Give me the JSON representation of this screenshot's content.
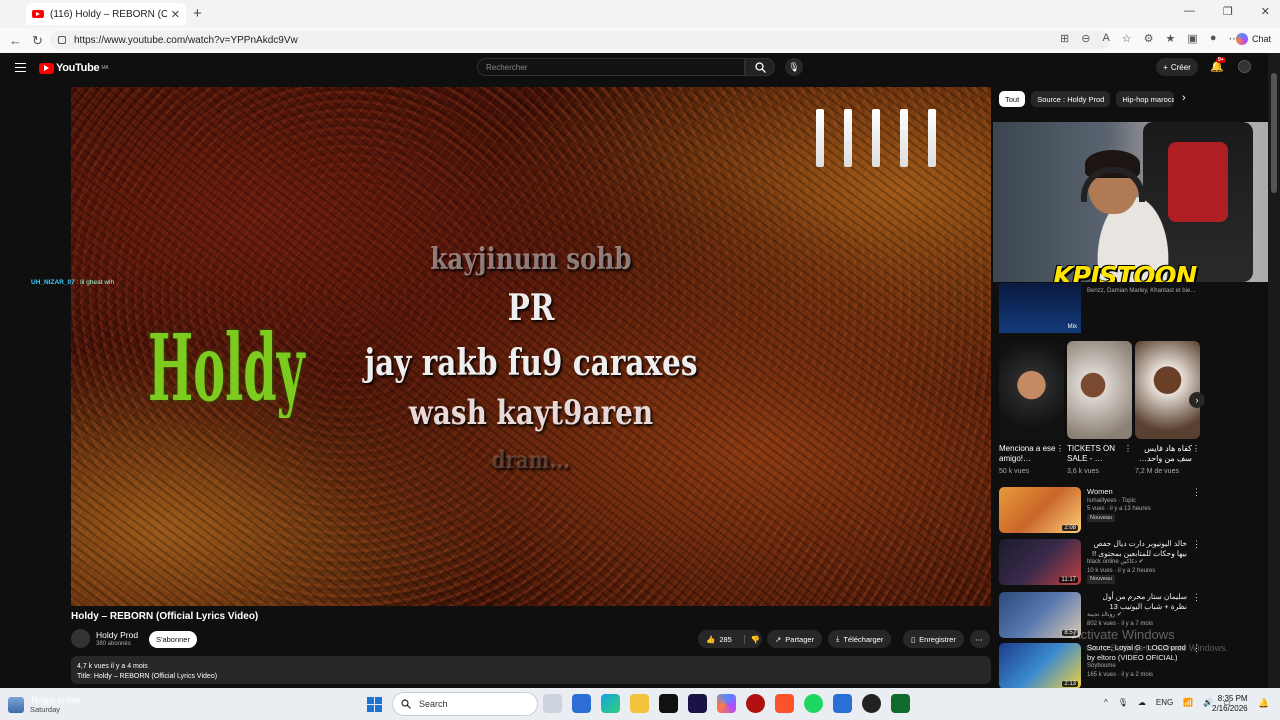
{
  "browser": {
    "tab_title": "(116) Holdy – REBORN (Official Lyr…",
    "url": "https://www.youtube.com/watch?v=YPPnAkdc9Vw",
    "chat_label": "Chat"
  },
  "youtube": {
    "logo": "YouTube",
    "logo_region": "MA",
    "search_placeholder": "Rechercher",
    "create_label": "Créer",
    "notifications": "9+"
  },
  "video": {
    "lyrics": [
      "kayjinum sohb",
      "PR",
      "jay rakb fu9 caraxes",
      "wash kayt9aren",
      "dram..."
    ],
    "logo_text": "Holdy",
    "chat_user": "UH_NIZAR_07",
    "chat_msg": ": lil gheat wlh",
    "title": "Holdy – REBORN (Official Lyrics Video)",
    "channel": "Holdy Prod",
    "subscribers": "380 abonnés",
    "subscribe_label": "S'abonner",
    "likes": "285",
    "share_label": "Partager",
    "download_label": "Télécharger",
    "save_label": "Enregistrer",
    "views_line": "4,7 k vues  il y a 4 mois",
    "desc_line": "Title: Holdy – REBORN (Official Lyrics Video)"
  },
  "webcam": {
    "brand_text": "KPISTOON"
  },
  "sidebar": {
    "chips": [
      "Tout",
      "Source : Holdy Prod",
      "Hip-hop marocain"
    ],
    "mix_label": "Mix",
    "mix_artists": "Benzz, Damian Marley, Khantast et bie…",
    "shorts": [
      {
        "title": "Menciona a ese amigo!…",
        "views": "50 k vues"
      },
      {
        "title": "TICKETS ON SALE - …",
        "views": "3,6 k vues"
      },
      {
        "title": "كفاه هاد فايس سف من واحد…",
        "views": "7,2 M de vues"
      }
    ],
    "recs": [
      {
        "title": "Women",
        "channel": "Ismaillyees · Topic",
        "meta": "5 vues · il y a 13 heures",
        "badge": "Nouveau",
        "duration": "2:08"
      },
      {
        "title": "خالد اليوتيوبر دارت ديال حفص بيها وحكات للمتابعين بمحتوى !!",
        "channel": "black online دكاكين ✔",
        "meta": "10 k vues · il y a 2 heures",
        "badge": "Nouveau",
        "duration": "11:17"
      },
      {
        "title": "سليمان ستار محرم من أول نظرة + شباب اليوتيب 13",
        "channel": "رونالد نجيبة ✔",
        "meta": "802 k vues · il y a 7 mois",
        "badge": "",
        "duration": "8:57"
      },
      {
        "title": "Source, Loyal G - LOCO prod by eltoro (VIDEO OFICIAL)",
        "channel": "Soyboume",
        "meta": "165 k vues · il y a 2 mois",
        "badge": "",
        "duration": "2:13"
      }
    ],
    "activate_title": "Activate Windows",
    "activate_sub": "Go to Settings to activate Windows."
  },
  "taskbar": {
    "weather_title": "Temps to rise",
    "weather_sub": "Saturday",
    "search_label": "Search",
    "lang": "ENG",
    "time": "8:35 PM",
    "date": "2/16/2026"
  }
}
